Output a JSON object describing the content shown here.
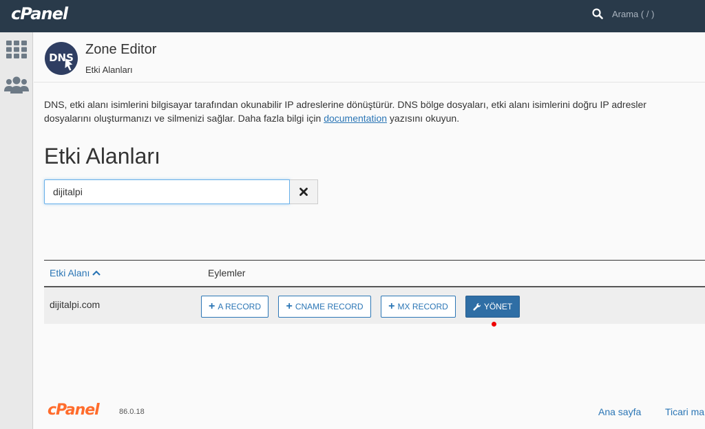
{
  "topbar": {
    "logo": "cPanel",
    "search_placeholder": "Arama ( / )"
  },
  "sidebar": {
    "items": [
      {
        "icon": "grid-icon"
      },
      {
        "icon": "users-icon"
      }
    ]
  },
  "header": {
    "app_icon_text": "DNS",
    "title": "Zone Editor",
    "breadcrumb": "Etki Alanları"
  },
  "description": {
    "line1": "DNS, etki alanı isimlerini bilgisayar tarafından okunabilir IP adreslerine dönüştürür. DNS bölge dosyaları, etki alanı isimlerini doğru IP adresler",
    "line2_before": "dosyalarını oluşturmanızı ve silmenizi sağlar. Daha fazla bilgi için ",
    "link": "documentation",
    "line2_after": " yazısını okuyun."
  },
  "section": {
    "title": "Etki Alanları"
  },
  "search": {
    "value": "dijitalpi"
  },
  "table": {
    "col_domain": "Etki Alanı",
    "col_actions": "Eylemler",
    "rows": [
      {
        "domain": "dijitalpi.com",
        "a_record": "A RECORD",
        "cname_record": "CNAME RECORD",
        "mx_record": "MX RECORD",
        "manage": "YÖNET"
      }
    ]
  },
  "footer": {
    "logo": "cPanel",
    "version": "86.0.18",
    "links": [
      "Ana sayfa",
      "Ticari ma"
    ]
  },
  "colors": {
    "topbar": "#293a4a",
    "link": "#2a75b5",
    "primary_button": "#2f6ea5",
    "brand_orange": "#ff6c2c"
  }
}
